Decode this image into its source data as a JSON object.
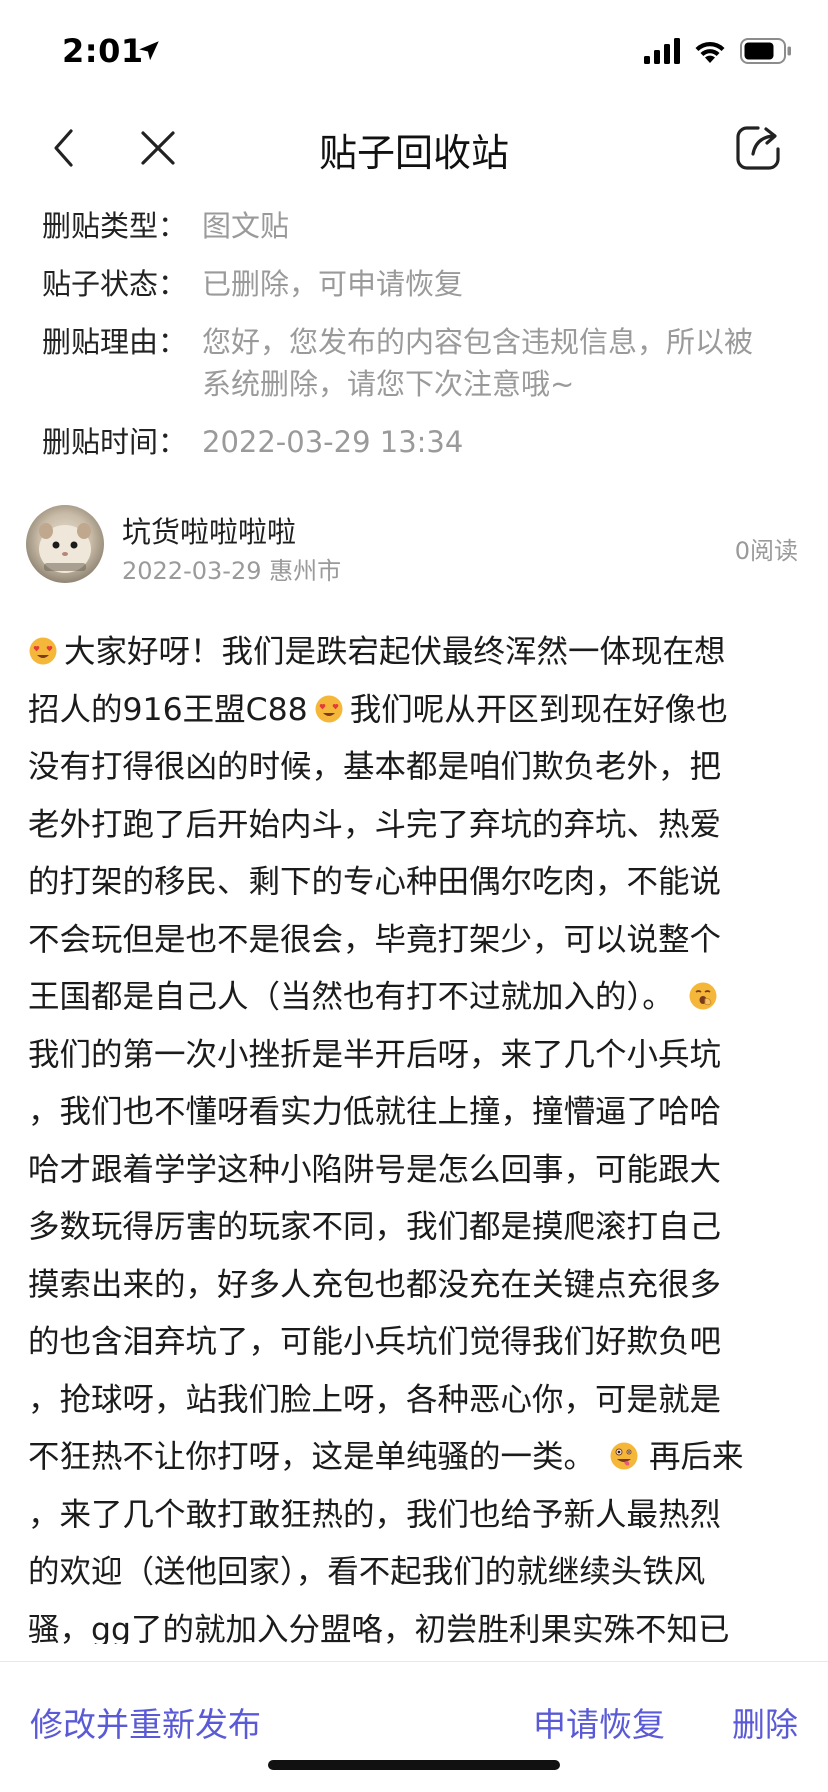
{
  "status_bar": {
    "time": "2:01",
    "icons": [
      "location-arrow-icon",
      "cellular-signal-icon",
      "wifi-icon",
      "battery-icon"
    ]
  },
  "nav": {
    "title": "贴子回收站",
    "icons": [
      "back-arrow-icon",
      "close-icon",
      "share-icon"
    ]
  },
  "info": {
    "type_label": "删贴类型：",
    "type_value": "图文贴",
    "status_label": "贴子状态：",
    "status_value": "已删除，可申请恢复",
    "reason_label": "删贴理由：",
    "reason_line1": "您好，您发布的内容包含违规信息，所以被",
    "reason_line2": "系统删除，请您下次注意哦~",
    "time_label": "删贴时间：",
    "time_value": "2022-03-29 13:34"
  },
  "author": {
    "name": "坑货啦啦啦啦",
    "meta": "2022-03-29 惠州市",
    "read_count": "0阅读",
    "avatar_icon": "hamster-avatar-icon"
  },
  "content": {
    "l1": "大家好呀！我们是跌宕起伏最终浑然一体现在想",
    "l2a": "招人的916王盟C88",
    "l2b": "我们呢从开区到现在好像也",
    "l3": "没有打得很凶的时候，基本都是咱们欺负老外，把",
    "l4": "老外打跑了后开始内斗，斗完了弃坑的弃坑、热爱",
    "l5": "的打架的移民、剩下的专心种田偶尔吃肉，不能说",
    "l6": "不会玩但是也不是很会，毕竟打架少，可以说整个",
    "l7": "王国都是自己人（当然也有打不过就加入的）。",
    "l8": "我们的第一次小挫折是半开后呀，来了几个小兵坑",
    "l9": "，我们也不懂呀看实力低就往上撞，撞懵逼了哈哈",
    "l10": "哈才跟着学学这种小陷阱号是怎么回事，可能跟大",
    "l11": "多数玩得厉害的玩家不同，我们都是摸爬滚打自己",
    "l12": "摸索出来的，好多人充包也都没充在关键点充很多",
    "l13": "的也含泪弃坑了，可能小兵坑们觉得我们好欺负吧",
    "l14": "，抢球呀，站我们脸上呀，各种恶心你，可是就是",
    "l15a": "不狂热不让你打呀，这是单纯骚的一类。",
    "l15b": "再后来",
    "l16": "，来了几个敢打敢狂热的，我们也给予新人最热烈",
    "l17": "的欢迎（送他回家），看不起我们的就继续头铁风",
    "l18": "骚，gg了的就加入分盟咯，初尝胜利果实殊不知已",
    "emojis": [
      "heart-eyes-emoji-icon",
      "heart-eyes-emoji-icon",
      "yawning-emoji-icon",
      "zany-face-emoji-icon"
    ]
  },
  "actions": {
    "edit_republish": "修改并重新发布",
    "request_restore": "申请恢复",
    "delete": "删除",
    "accent_color": "#5a5ad6"
  }
}
